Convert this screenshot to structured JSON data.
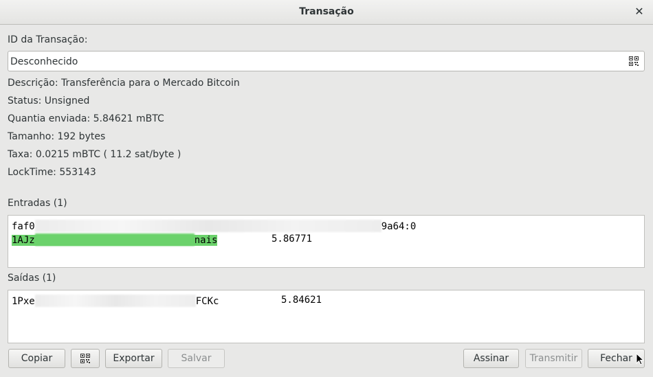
{
  "window": {
    "title": "Transação",
    "close_glyph": "✕"
  },
  "txid": {
    "label": "ID da Transação:",
    "value": "Desconhecido",
    "qr_icon": "qr-code-icon"
  },
  "details": {
    "description": "Descrição: Transferência para o Mercado Bitcoin",
    "status": "Status: Unsigned",
    "amount": "Quantia enviada: 5.84621 mBTC",
    "size": "Tamanho: 192 bytes",
    "fee": "Taxa: 0.0215 mBTC  ( 11.2 sat/byte )",
    "locktime": "LockTime: 553143"
  },
  "inputs": {
    "label": "Entradas (1)",
    "rows": [
      {
        "prevout_start": "faf0",
        "prevout_end": "9a64:0"
      },
      {
        "address_start": "1AJz",
        "address_end": "nais",
        "amount": "5.86771"
      }
    ]
  },
  "outputs": {
    "label": "Saídas (1)",
    "rows": [
      {
        "address_start": "1Pxe",
        "address_end": "FCKc",
        "amount": "5.84621"
      }
    ]
  },
  "buttons": {
    "copy": "Copiar",
    "qr_icon": "qr-code-icon",
    "export": "Exportar",
    "save": "Salvar",
    "sign": "Assinar",
    "broadcast": "Transmitir",
    "close": "Fechar"
  },
  "colors": {
    "window_bg": "#e8e8e7",
    "highlight_green": "#6bd26b",
    "disabled_text": "#8b8e8f"
  }
}
